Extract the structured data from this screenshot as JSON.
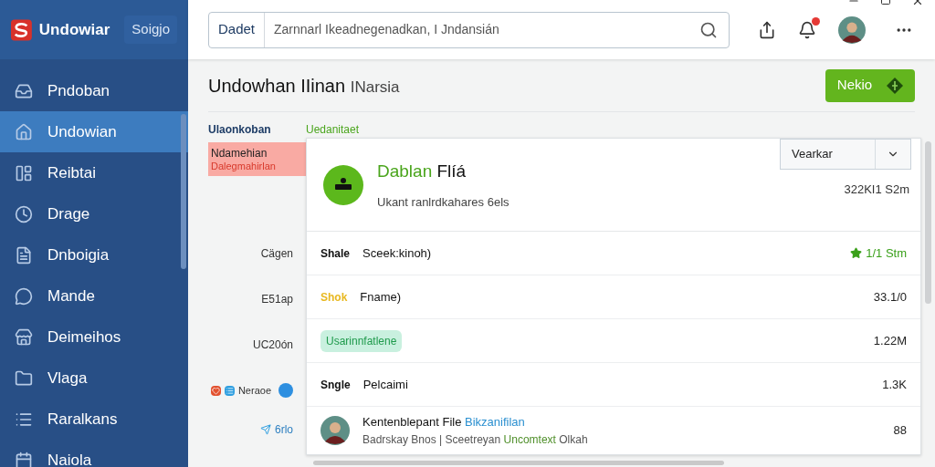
{
  "app": {
    "name": "Undowiar",
    "badge": "Soigjo"
  },
  "search": {
    "scope": "Dadet",
    "value": "Zarnnarl Ikeadnegenadkan, I Jndansián"
  },
  "header": {
    "notification_dot": true
  },
  "sidebar": {
    "items": [
      {
        "label": "Pndoban",
        "selected": false
      },
      {
        "label": "Undowian",
        "selected": true
      },
      {
        "label": "Reibtai",
        "selected": false
      },
      {
        "label": "Drage",
        "selected": false
      },
      {
        "label": "Dnboigia",
        "selected": false
      },
      {
        "label": "Mande",
        "selected": false
      },
      {
        "label": "Deimeihos",
        "selected": false
      },
      {
        "label": "Vlaga",
        "selected": false
      },
      {
        "label": "Raralkans",
        "selected": false
      },
      {
        "label": "Naiola",
        "selected": false
      }
    ]
  },
  "page": {
    "title": "Undowhan IIinan",
    "subtitle": "INarsia",
    "primary_button": "Nekio"
  },
  "left_panel": {
    "heading": "Ulaonkoban",
    "highlight": {
      "title": "Ndamehian",
      "subtitle": "Dalegmahirlan"
    },
    "labels": [
      {
        "kind": "text",
        "text": "Cägen"
      },
      {
        "kind": "text",
        "text": "E51ap"
      },
      {
        "kind": "text",
        "text": "UC20ón"
      },
      {
        "kind": "icons",
        "text": "Neraoe"
      },
      {
        "kind": "link",
        "text": "6rlo"
      }
    ]
  },
  "section_label": "Uedanitaet",
  "card": {
    "title": "Dablan",
    "title_rest": "Flíá",
    "subtitle": "Ukant ranlrdkahares 6els",
    "dropdown": "Vearkar",
    "time": "322KI1 S2m",
    "rows": [
      {
        "kind": "tag",
        "tag": "Shale",
        "color": "#111111",
        "text": "Sceek:kinoh)",
        "value": "1/1 Stm",
        "starred": true
      },
      {
        "kind": "tag",
        "tag": "Shok",
        "color": "#e8b820",
        "text": "Fname)",
        "value": "33.1/0",
        "starred": false
      },
      {
        "kind": "pill",
        "tag": "Usarinnfatlene",
        "value": "1.22M",
        "starred": false
      },
      {
        "kind": "tag",
        "tag": "Sngle",
        "color": "#111111",
        "text": "Pelcaimi",
        "value": "1.3K",
        "starred": false
      },
      {
        "kind": "person",
        "text": "Kentenblepant File",
        "link": "Bikzanifilan",
        "detail": "Badrskay Bnos | Sceetreyan",
        "detail_highlight": "Uncomtext",
        "detail_rest": "Olkah",
        "value": "88",
        "starred": false
      }
    ]
  }
}
